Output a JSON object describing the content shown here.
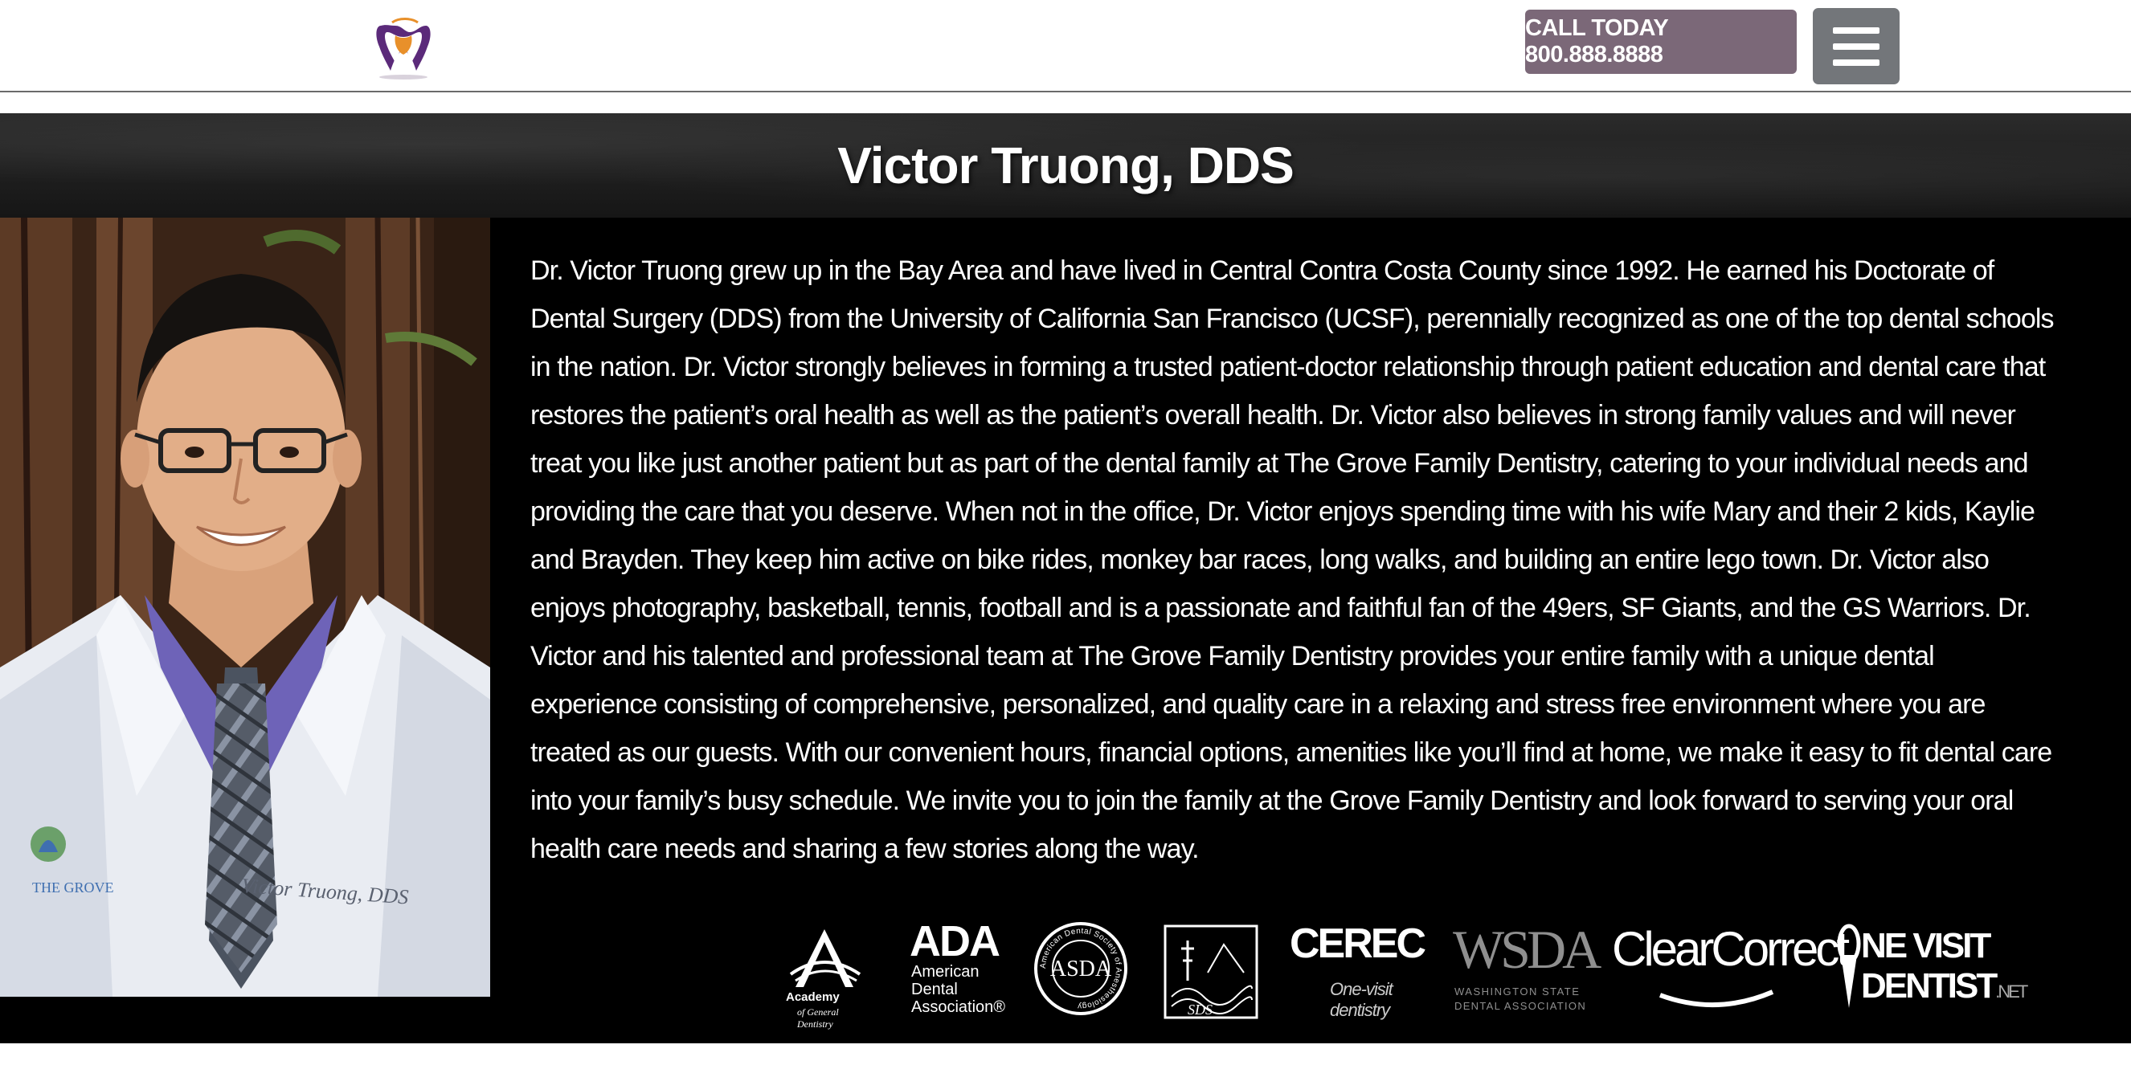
{
  "header": {
    "call_label": "CALL TODAY 800.888.8888"
  },
  "page": {
    "title": "Victor Truong, DDS",
    "bio": "Dr. Victor Truong grew up in the Bay Area and have lived in Central Contra Costa County since 1992. He earned his Doctorate of Dental Surgery (DDS) from the University of California San Francisco (UCSF), perennially recognized as one of the top dental schools in the nation. Dr. Victor strongly believes in forming a trusted patient-doctor relationship through patient education and dental care that restores the patient’s oral health as well as the patient’s overall health. Dr. Victor also believes in strong family values and will never treat you like just another patient but as part of the dental family at The Grove Family Dentistry, catering to your individual needs and providing the care that you deserve. When not in the office, Dr. Victor enjoys spending time with his wife Mary and their 2 kids, Kaylie and Brayden. They keep him active on bike rides, monkey bar races, long walks, and building an entire lego town. Dr. Victor also enjoys photography, basketball, tennis, football and is a passionate and faithful fan of the 49ers, SF Giants, and the GS Warriors. Dr. Victor and his talented and professional team at The Grove Family Dentistry provides your entire family with a unique dental experience consisting of comprehensive, personalized, and quality care in a relaxing and stress free environment where you are treated as our guests. With our convenient hours, financial options, amenities like you’ll find at home, we make it easy to fit dental care into your family’s busy schedule. We invite you to join the family at the Grove Family Dentistry and look forward to serving your oral health care needs and sharing a few stories along the way."
  },
  "photo": {
    "coat_name": "Victor Truong, DDS",
    "badge_text": "THE GROVE"
  },
  "affiliations": {
    "agd": {
      "line1": "Academy",
      "line2": "of General Dentistry"
    },
    "ada": {
      "mark": "ADA",
      "line1": "American",
      "line2": "Dental",
      "line3": "Association®"
    },
    "asda": {
      "ring": "American Dental Society of Anesthesiology",
      "mark": "ASDA"
    },
    "ss": {
      "mark": "SDS"
    },
    "cerec": {
      "mark": "CEREC",
      "tagline": "One-visit dentistry"
    },
    "wsda": {
      "mark": "WSDA",
      "line1": "WASHINGTON STATE",
      "line2": "DENTAL ASSOCIATION"
    },
    "clearcorrect": {
      "mark": "ClearCorrect"
    },
    "ovd": {
      "mark": "NE VISIT DENTIST",
      "suffix": ".NET"
    }
  },
  "colors": {
    "call_button": "#7b6878",
    "menu_button": "#73767a",
    "band": "#000000",
    "logo_purple": "#5b2a7a",
    "logo_orange": "#e8902a"
  },
  "icons": {
    "menu": "hamburger-icon",
    "logo": "tooth-logo-icon"
  }
}
